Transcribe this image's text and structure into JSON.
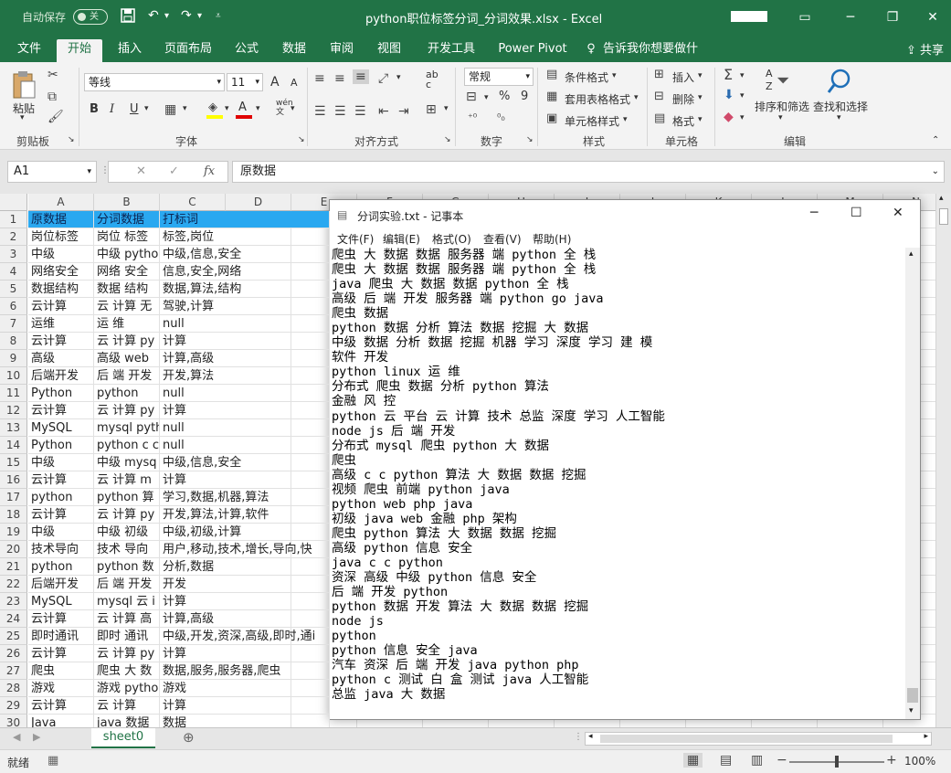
{
  "titlebar": {
    "autosave_label": "自动保存",
    "autosave_state": "关",
    "title": "python职位标签分词_分词效果.xlsx  -  Excel",
    "icons": [
      "save-icon",
      "undo-icon",
      "redo-icon",
      "customize-qa-icon"
    ],
    "window_controls": [
      "ribbon-display-icon",
      "minimize-icon",
      "restore-icon",
      "close-icon"
    ]
  },
  "tabs": [
    "文件",
    "开始",
    "插入",
    "页面布局",
    "公式",
    "数据",
    "审阅",
    "视图",
    "开发工具",
    "Power Pivot",
    "告诉我你想要做什么"
  ],
  "active_tab": "开始",
  "share_label": "共享",
  "ribbon": {
    "clipboard": {
      "paste": "粘贴",
      "group": "剪贴板"
    },
    "font": {
      "name": "等线",
      "size": "11",
      "bold": "B",
      "italic": "I",
      "underline": "U",
      "wen": "wén\n文",
      "font_color_letter": "A",
      "grow": "A",
      "shrink": "A",
      "group": "字体"
    },
    "alignment": {
      "wrap": "ab\nc",
      "group": "对齐方式"
    },
    "number": {
      "format": "常规",
      "percent": "%",
      "comma": "9",
      "group": "数字"
    },
    "styles": {
      "conditional": "条件格式",
      "table": "套用表格格式",
      "cell_styles": "单元格样式",
      "group": "样式"
    },
    "cells": {
      "insert": "插入",
      "delete": "删除",
      "format": "格式",
      "group": "单元格"
    },
    "editing": {
      "sort": "排序和筛选",
      "find": "查找和选择",
      "group": "编辑"
    },
    "accent": "#217346"
  },
  "formula_bar": {
    "name_box": "A1",
    "cancel": "✕",
    "enter": "✓",
    "fx": "fx",
    "content": "原数据"
  },
  "grid": {
    "columns": [
      "A",
      "B",
      "C",
      "D",
      "E",
      "F",
      "G",
      "H",
      "I",
      "J",
      "K",
      "L",
      "M",
      "N"
    ],
    "header_color": "#2aa8f0",
    "rows": [
      {
        "n": "1",
        "a": "原数据",
        "b": "分词数据",
        "c": "打标词"
      },
      {
        "n": "2",
        "a": "岗位标签",
        "b": "岗位 标签",
        "c": "标签,岗位"
      },
      {
        "n": "3",
        "a": "中级",
        "b": "中级 pytho",
        "c": "中级,信息,安全"
      },
      {
        "n": "4",
        "a": "网络安全",
        "b": "网络 安全",
        "c": "信息,安全,网络"
      },
      {
        "n": "5",
        "a": "数据结构",
        "b": "数据 结构",
        "c": "数据,算法,结构"
      },
      {
        "n": "6",
        "a": "云计算",
        "b": "云 计算 无",
        "c": "驾驶,计算"
      },
      {
        "n": "7",
        "a": "运维",
        "b": "运 维",
        "c": "null"
      },
      {
        "n": "8",
        "a": "云计算",
        "b": "云 计算 py",
        "c": "计算"
      },
      {
        "n": "9",
        "a": "高级",
        "b": "高级 web",
        "c": "计算,高级"
      },
      {
        "n": "10",
        "a": "后端开发",
        "b": "后 端 开发",
        "c": "开发,算法"
      },
      {
        "n": "11",
        "a": "Python",
        "b": "python",
        "c": "null"
      },
      {
        "n": "12",
        "a": "云计算",
        "b": "云 计算 py",
        "c": "计算"
      },
      {
        "n": "13",
        "a": "MySQL",
        "b": "mysql pyth",
        "c": "null"
      },
      {
        "n": "14",
        "a": "Python",
        "b": "python c c",
        "c": "null"
      },
      {
        "n": "15",
        "a": "中级",
        "b": "中级 mysq",
        "c": "中级,信息,安全"
      },
      {
        "n": "16",
        "a": "云计算",
        "b": "云 计算 m",
        "c": "计算"
      },
      {
        "n": "17",
        "a": "python",
        "b": "python 算",
        "c": "学习,数据,机器,算法"
      },
      {
        "n": "18",
        "a": "云计算",
        "b": "云 计算 py",
        "c": "开发,算法,计算,软件"
      },
      {
        "n": "19",
        "a": "中级",
        "b": "中级 初级",
        "c": "中级,初级,计算"
      },
      {
        "n": "20",
        "a": "技术导向",
        "b": "技术 导向",
        "c": "用户,移动,技术,增长,导向,快"
      },
      {
        "n": "21",
        "a": "python",
        "b": "python 数",
        "c": "分析,数据"
      },
      {
        "n": "22",
        "a": "后端开发",
        "b": "后 端 开发",
        "c": "开发"
      },
      {
        "n": "23",
        "a": "MySQL",
        "b": "mysql 云 i",
        "c": "计算"
      },
      {
        "n": "24",
        "a": "云计算",
        "b": "云 计算 高",
        "c": "计算,高级"
      },
      {
        "n": "25",
        "a": "即时通讯",
        "b": "即时 通讯",
        "c": "中级,开发,资深,高级,即时,通i"
      },
      {
        "n": "26",
        "a": "云计算",
        "b": "云 计算 py",
        "c": "计算"
      },
      {
        "n": "27",
        "a": "爬虫",
        "b": "爬虫 大 数",
        "c": "数据,服务,服务器,爬虫"
      },
      {
        "n": "28",
        "a": "游戏",
        "b": "游戏 pytho",
        "c": "游戏"
      },
      {
        "n": "29",
        "a": "云计算",
        "b": "云 计算",
        "c": "计算"
      },
      {
        "n": "30",
        "a": "Java",
        "b": "java 数据",
        "c": "数据"
      }
    ]
  },
  "sheet_tab": "sheet0",
  "status": {
    "ready": "就绪",
    "zoom": "100%"
  },
  "notepad": {
    "title": "分词实验.txt - 记事本",
    "menu": [
      "文件(F)",
      "编辑(E)",
      "格式(O)",
      "查看(V)",
      "帮助(H)"
    ],
    "lines": [
      "爬虫 大 数据 数据 服务器 端 python 全 栈",
      "爬虫 大 数据 数据 服务器 端 python 全 栈",
      "java 爬虫 大 数据 数据 python 全 栈",
      "高级 后 端 开发 服务器 端 python go java",
      "爬虫 数据",
      "python 数据 分析 算法 数据 挖掘 大 数据",
      "中级 数据 分析 数据 挖掘 机器 学习 深度 学习 建 模",
      "软件 开发",
      "python linux 运 维",
      "分布式 爬虫 数据 分析 python 算法",
      "金融 风 控",
      "python 云 平台 云 计算 技术 总监 深度 学习 人工智能",
      "node js 后 端 开发",
      "分布式 mysql 爬虫 python 大 数据",
      "爬虫",
      "高级 c c python 算法 大 数据 数据 挖掘",
      "视频 爬虫 前端 python java",
      "python web php java",
      "初级 java web 金融 php 架构",
      "爬虫 python 算法 大 数据 数据 挖掘",
      "高级 python 信息 安全",
      "java c c python",
      "资深 高级 中级 python 信息 安全",
      "后 端 开发 python",
      "python 数据 开发 算法 大 数据 数据 挖掘",
      "node js",
      "python",
      "python 信息 安全 java",
      "汽车 资深 后 端 开发 java python php",
      "python c 测试 白 盒 测试 java 人工智能",
      "总监 java 大 数据"
    ]
  }
}
